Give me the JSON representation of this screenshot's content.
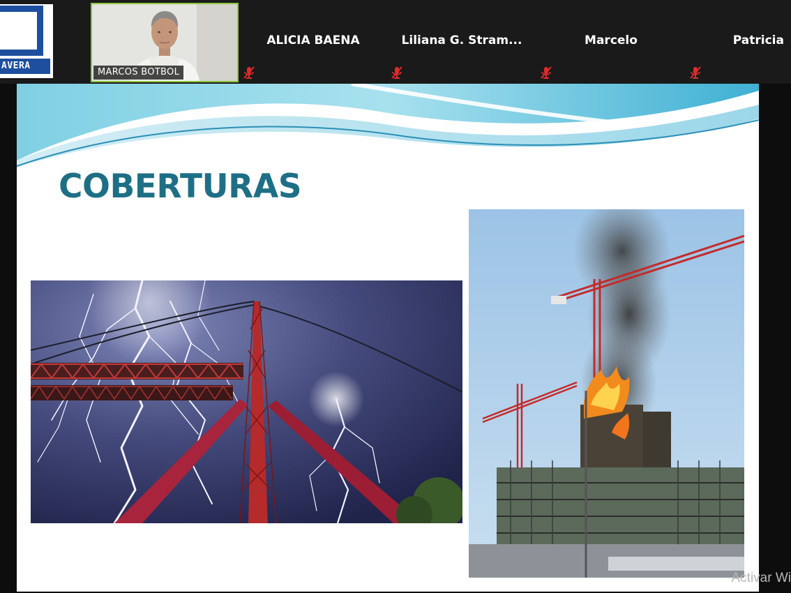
{
  "meeting": {
    "logo": {
      "word": "AVERA",
      "icon": "institution-logo"
    },
    "active_speaker": {
      "name": "MARCOS BOTBOL",
      "video": "camera-on"
    },
    "participants": [
      {
        "name": "ALICIA BAENA",
        "muted": true,
        "icon": "muted-mic-icon"
      },
      {
        "name": "Liliana G. Stram...",
        "muted": true,
        "icon": "muted-mic-icon"
      },
      {
        "name": "Marcelo",
        "muted": true,
        "icon": "muted-mic-icon"
      },
      {
        "name": "Patricia",
        "muted": true,
        "icon": "muted-mic-icon"
      }
    ],
    "colors": {
      "active_border": "#8dc63f",
      "muted_icon": "#e02b2b",
      "tile_bg": "#1a1a1a"
    }
  },
  "slide": {
    "title": "COBERTURAS",
    "title_color": "#1e6f86",
    "images": [
      {
        "subject": "suspension bridge tower struck by lightning at night"
      },
      {
        "subject": "building under construction on fire with tower cranes"
      }
    ]
  },
  "system": {
    "watermark": "Activar Wi"
  }
}
